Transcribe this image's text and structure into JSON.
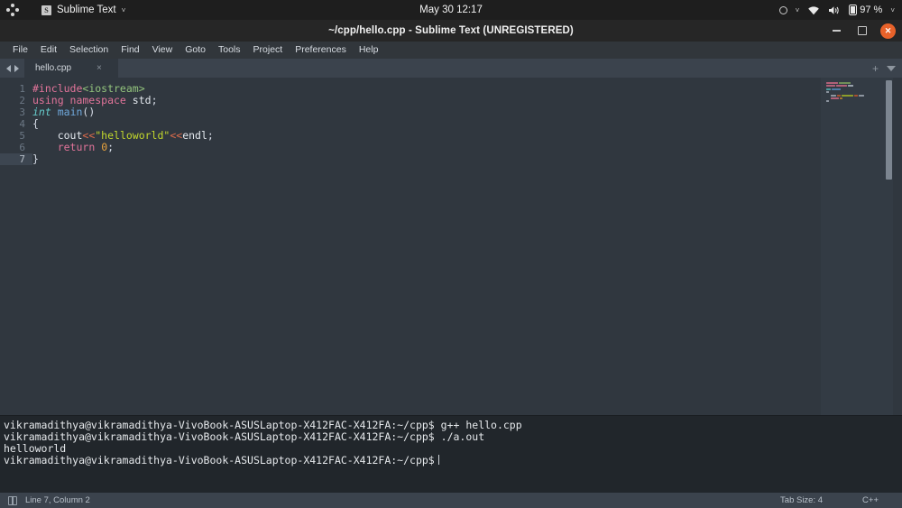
{
  "gnome_panel": {
    "activities_icon": "apps-grid-icon",
    "app_icon": "sublime-text-icon",
    "app_name": "Sublime Text",
    "app_chevron": "˅",
    "clock": "May 30  12:17",
    "tray": {
      "record_indicator": "circle-icon",
      "record_chevron": "˅",
      "wifi": "wifi-icon",
      "volume": "volume-icon",
      "battery": "battery-icon",
      "battery_pct": "97 %",
      "system_chevron": "˅"
    }
  },
  "window": {
    "title": "~/cpp/hello.cpp - Sublime Text (UNREGISTERED)",
    "controls": {
      "minimize": "minimize-icon",
      "maximize": "maximize-icon",
      "close": "✕"
    }
  },
  "menubar": {
    "items": [
      "File",
      "Edit",
      "Selection",
      "Find",
      "View",
      "Goto",
      "Tools",
      "Project",
      "Preferences",
      "Help"
    ]
  },
  "tabbar": {
    "prev_arrow": "arrow-left-icon",
    "next_arrow": "arrow-right-icon",
    "tabs": [
      {
        "label": "hello.cpp",
        "close": "×",
        "active": true
      }
    ],
    "new_tab": "+",
    "overflow": "chevron-down-icon"
  },
  "editor": {
    "line_numbers": [
      "1",
      "2",
      "3",
      "4",
      "5",
      "6",
      "7"
    ],
    "active_line": 7,
    "lines": [
      "#include<iostream>",
      "using namespace std;",
      "int main()",
      "{",
      "    cout<<\"helloworld\"<<endl;",
      "    return 0;",
      "}"
    ]
  },
  "terminal": {
    "prompt": "vikramadithya@vikramadithya-VivoBook-ASUSLaptop-X412FAC-X412FA:~/cpp$",
    "lines": [
      "vikramadithya@vikramadithya-VivoBook-ASUSLaptop-X412FAC-X412FA:~/cpp$ g++ hello.cpp",
      "vikramadithya@vikramadithya-VivoBook-ASUSLaptop-X412FAC-X412FA:~/cpp$ ./a.out",
      "helloworld",
      "vikramadithya@vikramadithya-VivoBook-ASUSLaptop-X412FAC-X412FA:~/cpp$"
    ]
  },
  "statusbar": {
    "sidebar_icon": "sidebar-toggle-icon",
    "position": "Line 7, Column 2",
    "tab_size": "Tab Size: 4",
    "syntax": "C++"
  },
  "colors": {
    "panel_bg": "#1e1e1e",
    "titlebar_bg": "#262626",
    "menubar_bg": "#31363b",
    "tabbar_bg": "#3b434d",
    "editor_bg": "#30373f",
    "terminal_bg": "#21262b",
    "statusbar_bg": "#3b434d",
    "close_button": "#e8622a",
    "keyword": "#e2749a",
    "string": "#c3d82c",
    "operator": "#e06c4b",
    "number": "#e8a33d",
    "type": "#66cccc",
    "function": "#6fa8dc",
    "include_path": "#93c47d"
  }
}
